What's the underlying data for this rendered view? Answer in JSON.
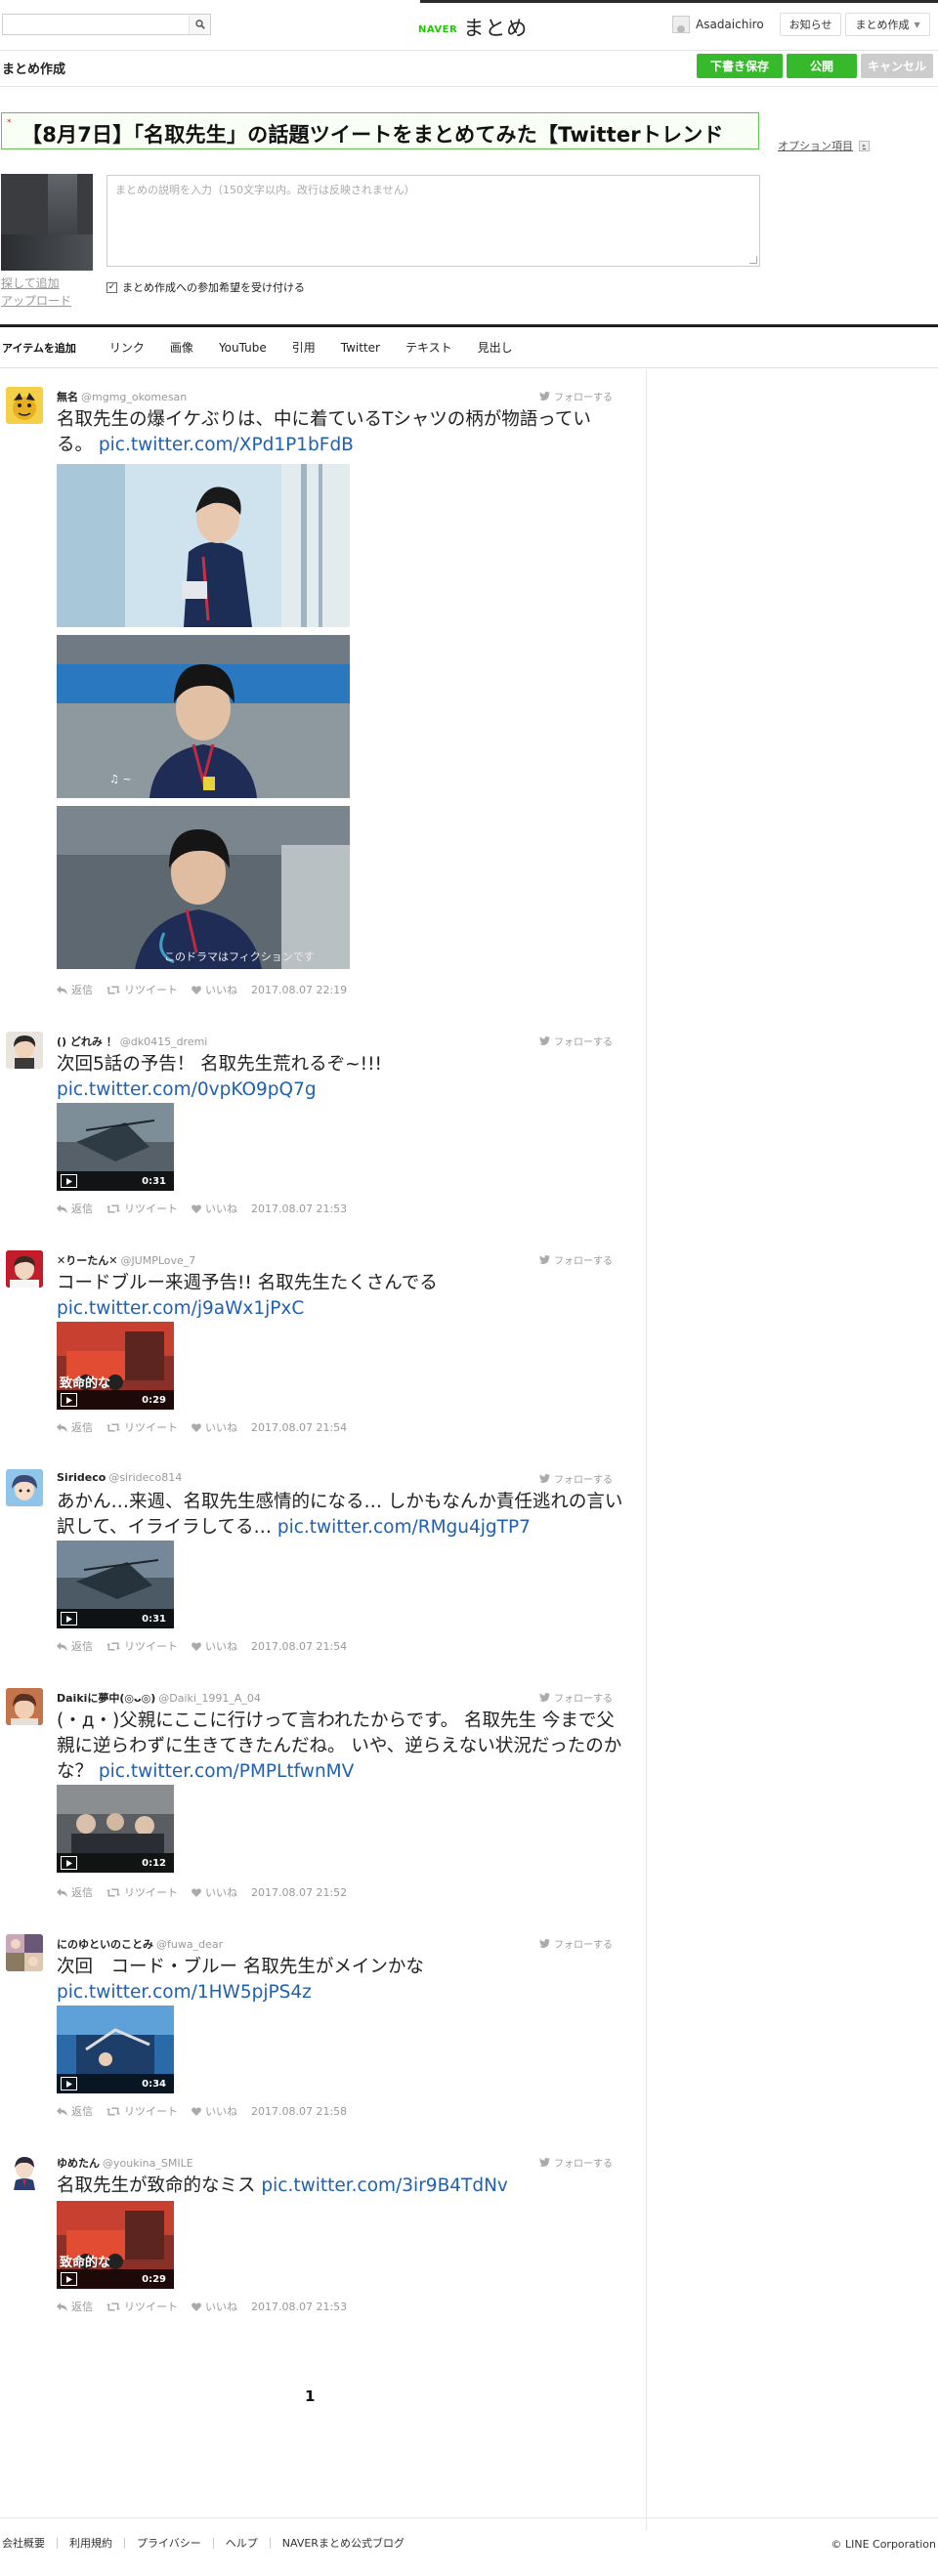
{
  "header": {
    "search_placeholder": "",
    "logo_prefix": "NAVER",
    "logo_text": "まとめ",
    "username": "Asadaichiro",
    "notifications_label": "お知らせ",
    "create_label": "まとめ作成"
  },
  "editor": {
    "page_title": "まとめ作成",
    "draft_label": "下書き保存",
    "publish_label": "公開",
    "cancel_label": "キャンセル",
    "title_required_mark": "*",
    "title_value": "【8月7日】「名取先生」の話題ツイートをまとめてみた【Twitterトレンド",
    "option_label": "オプション項目",
    "description_placeholder": "まとめの説明を入力（150文字以内。改行は反映されません）",
    "thumb_search_label": "探して追加",
    "thumb_upload_label": "アップロード",
    "join_label": "まとめ作成への参加希望を受け付ける",
    "join_checked": true
  },
  "item_bar": {
    "title": "アイテムを追加",
    "tabs": [
      "リンク",
      "画像",
      "YouTube",
      "引用",
      "Twitter",
      "テキスト",
      "見出し"
    ]
  },
  "tweet_actions": {
    "reply": "返信",
    "retweet": "リツイート",
    "like": "いいね",
    "follow": "フォローする"
  },
  "tweets": [
    {
      "name": "無名",
      "handle": "@mgmg_okomesan",
      "text": "名取先生の爆イケぶりは、中に着ているTシャツの柄が物語っている。",
      "link": "pic.twitter.com/XPd1P1bFdB",
      "timestamp": "2017.08.07 22:19",
      "photo_caption_1": "♫ ~",
      "photo_caption_2": "このドラマはフィクションです"
    },
    {
      "name": "() どれみ ！",
      "handle": "@dk0415_dremi",
      "text": "次回5話の予告！ 名取先生荒れるぞ~!!!",
      "link": "pic.twitter.com/0vpKO9pQ7g",
      "duration": "0:31",
      "timestamp": "2017.08.07 21:53"
    },
    {
      "name": "✕りーたん✕",
      "handle": "@JUMPLove_7",
      "text": "コードブルー来週予告!! 名取先生たくさんでる",
      "link": "pic.twitter.com/j9aWx1jPxC",
      "duration": "0:29",
      "video_caption": "致命的な",
      "timestamp": "2017.08.07 21:54"
    },
    {
      "name": "Sirideco",
      "handle": "@sirideco814",
      "text": "あかん…来週、名取先生感情的になる… しかもなんか責任逃れの言い訳して、イライラしてる…",
      "link": "pic.twitter.com/RMgu4jgTP7",
      "duration": "0:31",
      "timestamp": "2017.08.07 21:54"
    },
    {
      "name": "Daikiに夢中(◎ᴗ◎)",
      "handle": "@Daiki_1991_A_04",
      "text": "(・д・)父親にここに行けって言われたからです。 名取先生 今まで父親に逆らわずに生きてきたんだね。 いや、逆らえない状況だったのかな？",
      "link": "pic.twitter.com/PMPLtfwnMV",
      "duration": "0:12",
      "timestamp": "2017.08.07 21:52"
    },
    {
      "name": "にのゆといのことみ",
      "handle": "@fuwa_dear",
      "text": "次回　コード・ブルー 名取先生がメインかな",
      "link": "pic.twitter.com/1HW5pjPS4z",
      "duration": "0:34",
      "timestamp": "2017.08.07 21:58"
    },
    {
      "name": "ゆめたん",
      "handle": "@youkina_SMILE",
      "text": "名取先生が致命的なミス",
      "link": "pic.twitter.com/3ir9B4TdNv",
      "duration": "0:29",
      "video_caption": "致命的な",
      "timestamp": "2017.08.07 21:53"
    }
  ],
  "pagination": {
    "current": "1"
  },
  "footer": {
    "links": [
      "会社概要",
      "利用規約",
      "プライバシー",
      "ヘルプ",
      "NAVERまとめ公式ブログ"
    ],
    "copyright": "© LINE Corporation"
  },
  "colors": {
    "accent_green": "#36b92b",
    "title_border": "#64c255",
    "link_blue": "#2060b0",
    "cancel_gray": "#cccccc"
  },
  "icons": {
    "search": "search-icon",
    "follow": "twitter-bird-icon",
    "reply": "reply-icon",
    "retweet": "retweet-icon",
    "like": "heart-icon",
    "play": "play-icon"
  }
}
